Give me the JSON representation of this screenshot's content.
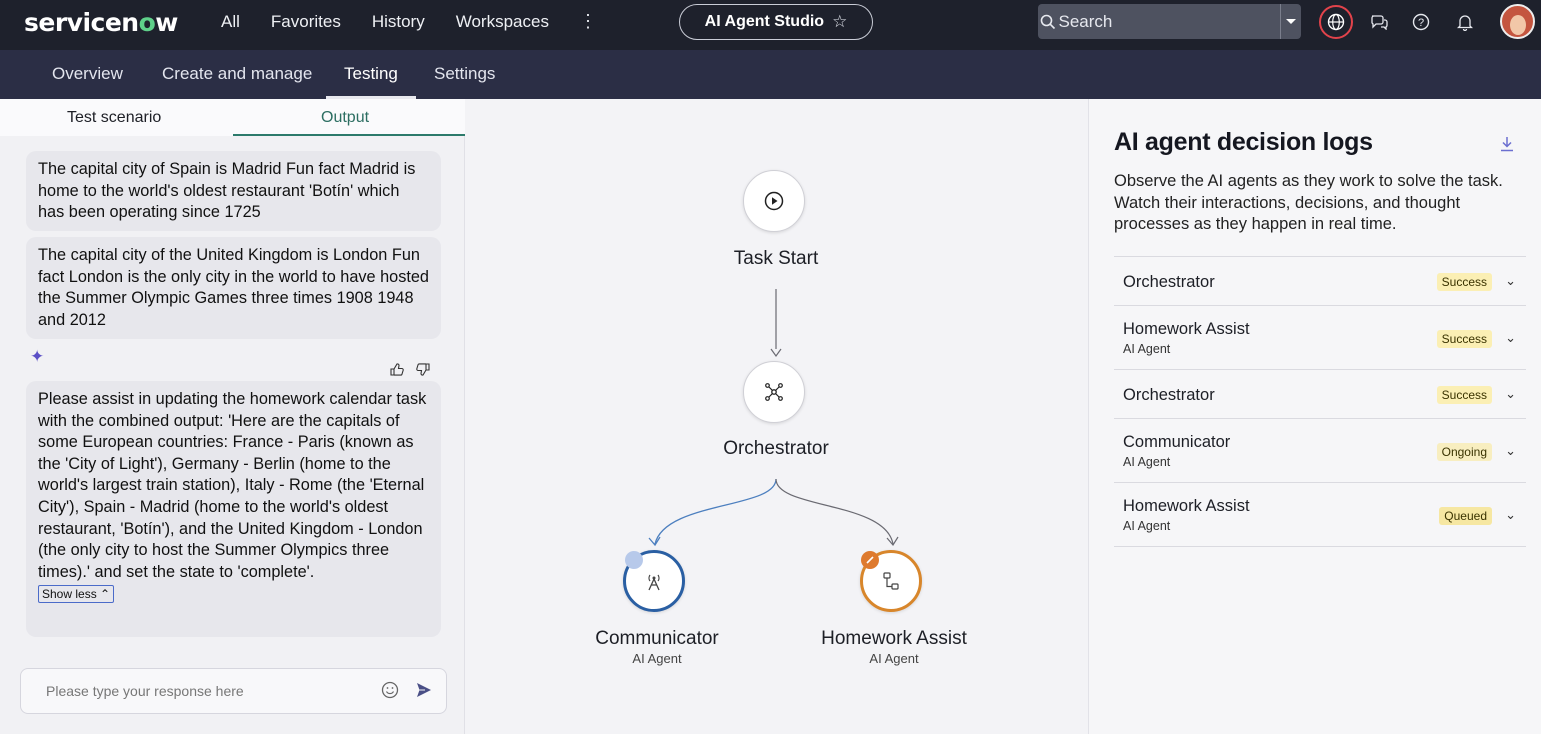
{
  "topbar": {
    "logo": {
      "pre": "servicen",
      "o": "o",
      "post": "w"
    },
    "nav": [
      "All",
      "Favorites",
      "History",
      "Workspaces"
    ],
    "more_icon": "kebab-icon",
    "app_title": "AI Agent Studio",
    "search_placeholder": "Search",
    "icons": [
      "globe-icon",
      "chat-icon",
      "help-icon",
      "bell-icon"
    ]
  },
  "subnav": {
    "tabs": [
      "Overview",
      "Create and manage",
      "Testing",
      "Settings"
    ],
    "active": "Testing"
  },
  "left": {
    "tabs": {
      "scenario": "Test scenario",
      "output": "Output"
    },
    "messages": [
      {
        "text": "The capital city of Spain is Madrid Fun fact Madrid is home to the world's oldest restaurant 'Botín' which has been operating since 1725"
      },
      {
        "text": "The capital city of the United Kingdom is London Fun fact London is the only city in the world to have hosted the Summer Olympic Games three times 1908 1948 and 2012"
      },
      {
        "text": "Please assist in updating the homework calendar task with the combined output: 'Here are the capitals of some European countries: France - Paris (known as the 'City of Light'), Germany - Berlin (home to the world's largest train station), Italy - Rome (the 'Eternal City'), Spain - Madrid (home to the world's oldest restaurant, 'Botín'), and the United Kingdom - London (the only city to host the Summer Olympics three times).' and set the state to 'complete'."
      }
    ],
    "show_less": "Show less",
    "composer_placeholder": "Please type your response here"
  },
  "canvas": {
    "nodes": [
      {
        "label": "Task Start",
        "sub": ""
      },
      {
        "label": "Orchestrator",
        "sub": ""
      },
      {
        "label": "Communicator",
        "sub": "AI Agent"
      },
      {
        "label": "Homework Assist",
        "sub": "AI Agent"
      }
    ]
  },
  "logs": {
    "title": "AI agent decision logs",
    "description": "Observe the AI agents as they work to solve the task. Watch their interactions, decisions, and thought processes as they happen in real time.",
    "rows": [
      {
        "name": "Orchestrator",
        "sub": "",
        "status": "Success"
      },
      {
        "name": "Homework Assist",
        "sub": "AI Agent",
        "status": "Success"
      },
      {
        "name": "Orchestrator",
        "sub": "",
        "status": "Success"
      },
      {
        "name": "Communicator",
        "sub": "AI Agent",
        "status": "Ongoing"
      },
      {
        "name": "Homework Assist",
        "sub": "AI Agent",
        "status": "Queued"
      }
    ]
  },
  "colors": {
    "topbar": "#1e212c",
    "subnav": "#2b2e45",
    "success_badge": "#fbefb4",
    "ongoing_badge": "#f8eec0",
    "queued_badge": "#f6e7a2",
    "communicator_ring": "#2a5fa3",
    "homework_ring": "#d8862b"
  }
}
